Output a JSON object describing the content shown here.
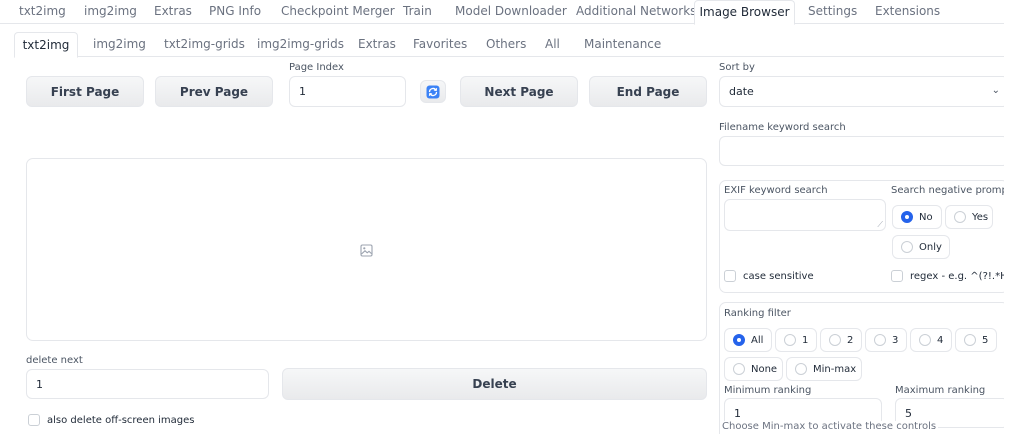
{
  "top_tabs": [
    {
      "label": "txt2img"
    },
    {
      "label": "img2img"
    },
    {
      "label": "Extras"
    },
    {
      "label": "PNG Info"
    },
    {
      "label": "Checkpoint Merger"
    },
    {
      "label": "Train"
    },
    {
      "label": "Model Downloader"
    },
    {
      "label": "Additional Networks"
    },
    {
      "label": "Image Browser",
      "active": true
    },
    {
      "label": "Settings"
    },
    {
      "label": "Extensions"
    }
  ],
  "sub_tabs": [
    {
      "label": "txt2img",
      "active": true
    },
    {
      "label": "img2img"
    },
    {
      "label": "txt2img-grids"
    },
    {
      "label": "img2img-grids"
    },
    {
      "label": "Extras"
    },
    {
      "label": "Favorites"
    },
    {
      "label": "Others"
    },
    {
      "label": "All"
    },
    {
      "label": "Maintenance"
    }
  ],
  "paging": {
    "first_label": "First Page",
    "prev_label": "Prev Page",
    "page_index_label": "Page Index",
    "page_index_value": "1",
    "next_label": "Next Page",
    "end_label": "End Page",
    "refresh_icon": "refresh-icon"
  },
  "gallery": {
    "placeholder_icon": "image-icon"
  },
  "delete": {
    "delete_next_label": "delete next",
    "delete_next_value": "1",
    "delete_button": "Delete",
    "offscreen_label": "also delete off-screen images"
  },
  "sort": {
    "label": "Sort by",
    "value": "date"
  },
  "filename_search": {
    "label": "Filename keyword search",
    "value": ""
  },
  "exif": {
    "label": "EXIF keyword search",
    "value": "",
    "negative_label": "Search negative prompt",
    "negative_options": [
      {
        "label": "No",
        "selected": true
      },
      {
        "label": "Yes"
      },
      {
        "label": "Only"
      }
    ],
    "case_label": "case sensitive",
    "regex_label": "regex - e.g. ^(?!.*Hires"
  },
  "ranking": {
    "label": "Ranking filter",
    "options": [
      {
        "label": "All",
        "selected": true
      },
      {
        "label": "1"
      },
      {
        "label": "2"
      },
      {
        "label": "3"
      },
      {
        "label": "4"
      },
      {
        "label": "5"
      },
      {
        "label": "None"
      },
      {
        "label": "Min-max"
      }
    ],
    "min_label": "Minimum ranking",
    "min_value": "1",
    "max_label": "Maximum ranking",
    "max_value": "5",
    "hint": "Choose Min-max to activate these controls"
  },
  "colors": {
    "accent": "#2563eb",
    "border": "#e5e7eb",
    "button": "#eceef0"
  }
}
